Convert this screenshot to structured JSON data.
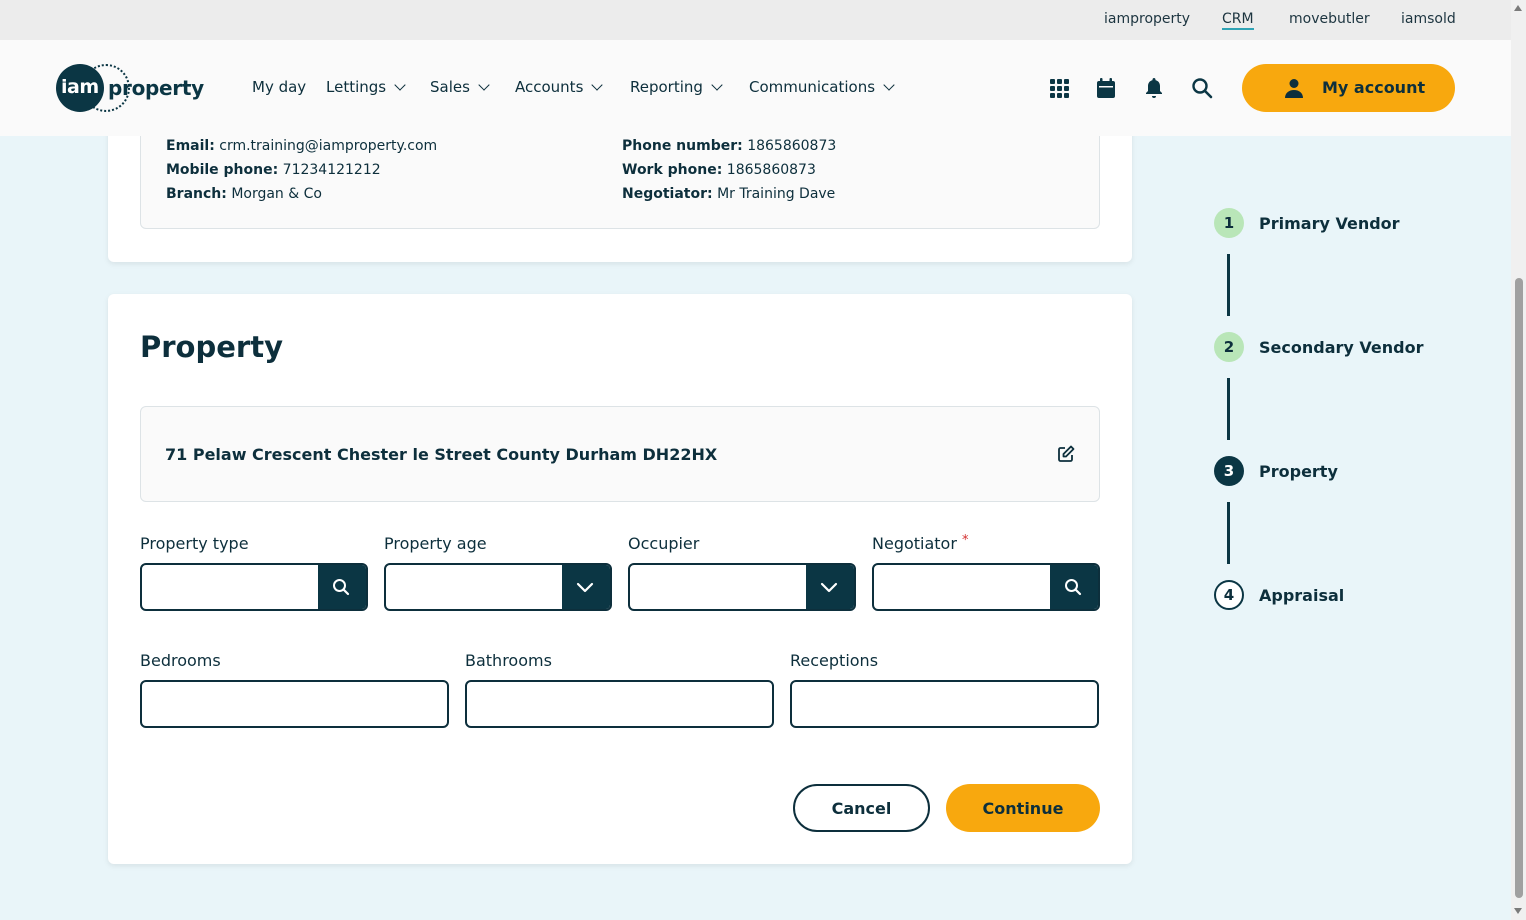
{
  "topbar": {
    "links": [
      {
        "label": "iamproperty"
      },
      {
        "label": "CRM",
        "active": true
      },
      {
        "label": "movebutler"
      },
      {
        "label": "iamsold"
      }
    ]
  },
  "header": {
    "logo": {
      "part1": "iam",
      "part2": "property"
    },
    "nav": [
      {
        "label": "My day",
        "dropdown": false
      },
      {
        "label": "Lettings",
        "dropdown": true
      },
      {
        "label": "Sales",
        "dropdown": true
      },
      {
        "label": "Accounts",
        "dropdown": true
      },
      {
        "label": "Reporting",
        "dropdown": true
      },
      {
        "label": "Communications",
        "dropdown": true
      }
    ],
    "icons": [
      "apps-grid-icon",
      "calendar-icon",
      "bell-icon",
      "search-icon"
    ],
    "account_label": "My account"
  },
  "vendor": {
    "email_label": "Email:",
    "email": "crm.training@iamproperty.com",
    "mobile_label": "Mobile phone:",
    "mobile": "71234121212",
    "branch_label": "Branch:",
    "branch": "Morgan & Co",
    "phone_label": "Phone number:",
    "phone": "1865860873",
    "work_label": "Work phone:",
    "work": "1865860873",
    "negotiator_label": "Negotiator:",
    "negotiator": "Mr Training Dave"
  },
  "property": {
    "title": "Property",
    "address": "71 Pelaw Crescent Chester le Street County Durham DH22HX",
    "fields": {
      "property_type": {
        "label": "Property type",
        "value": ""
      },
      "property_age": {
        "label": "Property age",
        "value": ""
      },
      "occupier": {
        "label": "Occupier",
        "value": ""
      },
      "negotiator": {
        "label": "Negotiator",
        "required_mark": "*",
        "value": ""
      },
      "bedrooms": {
        "label": "Bedrooms",
        "value": ""
      },
      "bathrooms": {
        "label": "Bathrooms",
        "value": ""
      },
      "receptions": {
        "label": "Receptions",
        "value": ""
      }
    },
    "cancel_label": "Cancel",
    "continue_label": "Continue"
  },
  "stepper": {
    "steps": [
      {
        "number": "1",
        "label": "Primary Vendor",
        "state": "done"
      },
      {
        "number": "2",
        "label": "Secondary Vendor",
        "state": "done"
      },
      {
        "number": "3",
        "label": "Property",
        "state": "current"
      },
      {
        "number": "4",
        "label": "Appraisal",
        "state": "todo"
      }
    ]
  },
  "colors": {
    "accent": "#f8a80e",
    "primary_dark": "#0b3644",
    "background": "#e9f5f9",
    "step_done": "#b9e6b8"
  }
}
